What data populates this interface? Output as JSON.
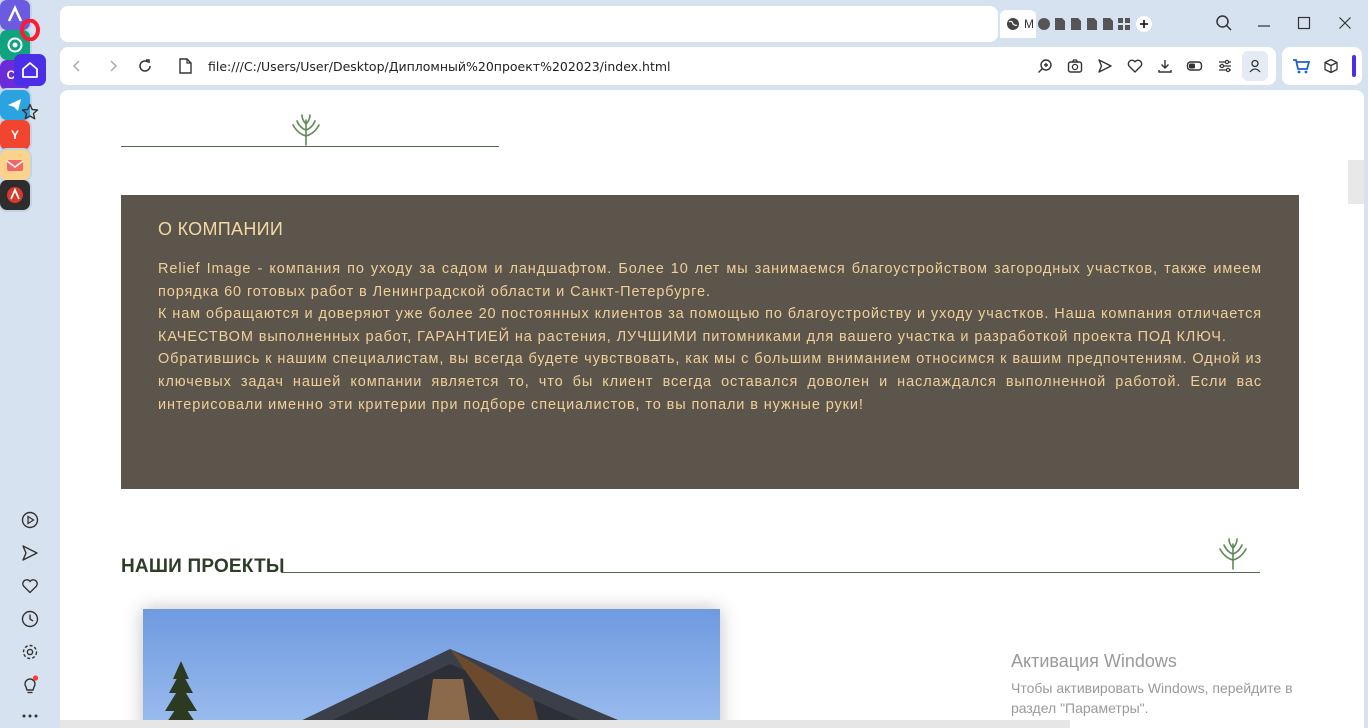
{
  "browser": {
    "url": "file:///C:/Users/User/Desktop/Дипломный%20проект%202023/index.html",
    "first_tab_initial": "M",
    "brand_color": "#4b2ee8"
  },
  "sidebar": {
    "apps": [
      {
        "name": "aria",
        "label": "",
        "color": "#ff5a4f"
      },
      {
        "name": "chatgpt",
        "label": "",
        "color": "#10a37f"
      },
      {
        "name": "cs",
        "label": "CS",
        "color": "#6c2bd9"
      },
      {
        "name": "telegram",
        "label": "",
        "color": "#2aa3e0"
      },
      {
        "name": "yandex",
        "label": "Y",
        "color": "#f2452f"
      },
      {
        "name": "mail",
        "label": "",
        "color": "#f5a623"
      },
      {
        "name": "lingvo",
        "label": "",
        "color": "#d9392d"
      }
    ]
  },
  "page": {
    "about": {
      "title": "О КОМПАНИИ",
      "p1": "Relief Image - компания по уходу за садом и ландшафтом. Более 10 лет мы занимаемся благоустройством загородных участков, также имеем порядка 60 готовых работ в Ленинградской области и Санкт-Петербурге.",
      "p2": "К нам обращаются и доверяют уже более 20 постоянных клиентов за помощью по благоустройству и уходу участков. Наша компания отличается КАЧЕСТВОМ выполненных работ, ГАРАНТИЕЙ на растения, ЛУЧШИМИ питомниками для вашего участка и разработкой проекта ПОД КЛЮЧ.",
      "p3": "Обратившись к нашим специалистам, вы всегда будете чувствовать, как мы с большим вниманием относимся к вашим предпочтениям. Одной из ключевых задач нашей компании является то, что бы клиент всегда оставался доволен и наслаждался выполненной работой. Если вас интерисовали именно эти критерии при подборе специалистов, то вы попали в нужные руки!",
      "bg_color": "#5b554c",
      "text_color": "#f0cf98"
    },
    "projects": {
      "title": "НАШИ ПРОЕКТЫ"
    }
  },
  "overlay": {
    "activation_title": "Активация Windows",
    "activation_line1": "Чтобы активировать Windows, перейдите в",
    "activation_line2": "раздел \"Параметры\"."
  }
}
